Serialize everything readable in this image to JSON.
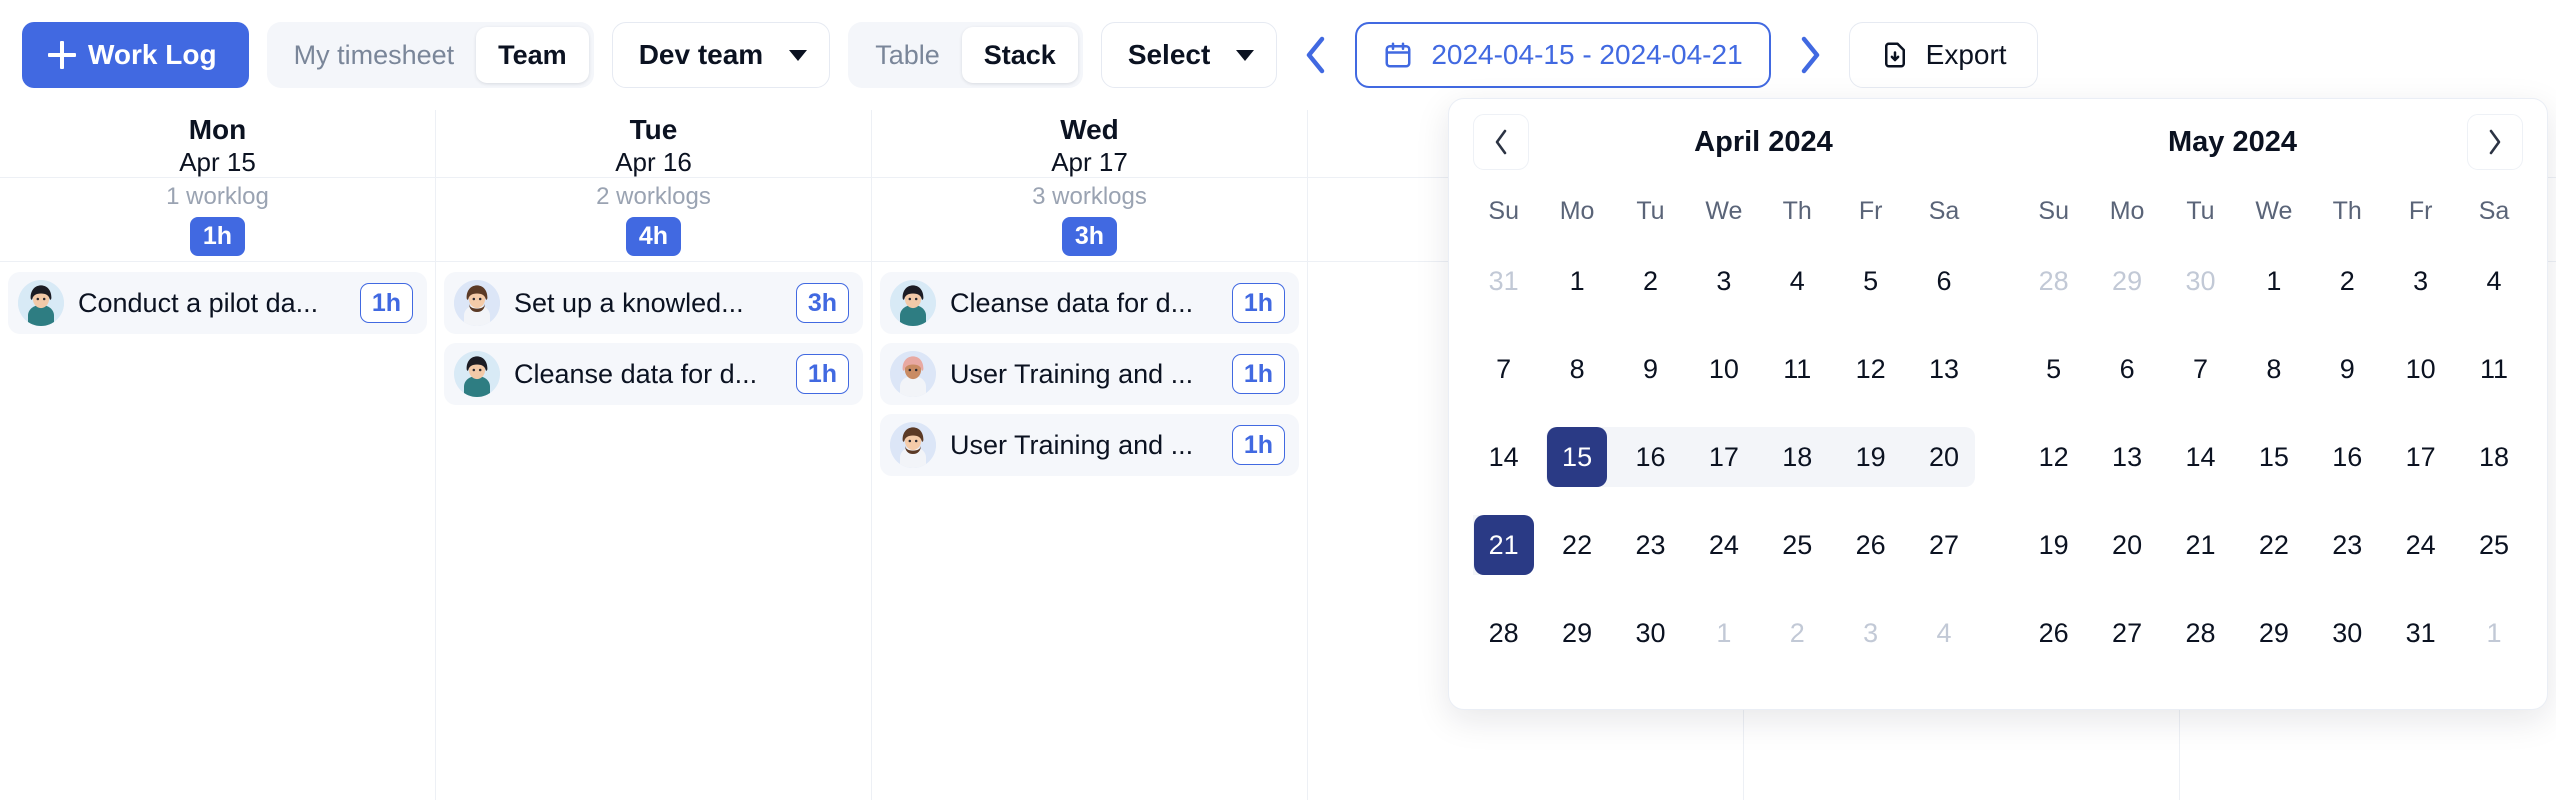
{
  "colors": {
    "primary": "#4169E1",
    "selected_day": "#2A3A85",
    "range_bg": "#F3F5F9",
    "card_bg": "#F5F7FB",
    "muted_text": "#9AA3B2"
  },
  "toolbar": {
    "work_log_button": "Work Log",
    "plus_icon": "plus-icon",
    "scope_segmented": {
      "options": [
        "My timesheet",
        "Team"
      ],
      "selected": "Team"
    },
    "team_dropdown": {
      "value": "Dev team",
      "chevron_icon": "chevron-down-icon"
    },
    "view_segmented": {
      "options": [
        "Table",
        "Stack"
      ],
      "selected": "Stack"
    },
    "select_dropdown": {
      "value": "Select",
      "chevron_icon": "chevron-down-icon"
    },
    "prev_week_icon": "chevron-left-icon",
    "next_week_icon": "chevron-right-icon",
    "date_range": {
      "value": "2024-04-15 - 2024-04-21",
      "calendar_icon": "calendar-icon"
    },
    "export_button": {
      "label": "Export",
      "icon": "file-download-icon"
    }
  },
  "week": {
    "columns": [
      {
        "day_name": "Mon",
        "day_date": "Apr 15",
        "worklog_count": "1 worklog",
        "total": "1h",
        "cards": [
          {
            "title": "Conduct a pilot da...",
            "hours": "1h",
            "avatar": "avatar-woman-dark-hair"
          }
        ]
      },
      {
        "day_name": "Tue",
        "day_date": "Apr 16",
        "worklog_count": "2 worklogs",
        "total": "4h",
        "cards": [
          {
            "title": "Set up a knowled...",
            "hours": "3h",
            "avatar": "avatar-man-beard"
          },
          {
            "title": "Cleanse data for d...",
            "hours": "1h",
            "avatar": "avatar-woman-dark-hair"
          }
        ]
      },
      {
        "day_name": "Wed",
        "day_date": "Apr 17",
        "worklog_count": "3 worklogs",
        "total": "3h",
        "cards": [
          {
            "title": "Cleanse data for d...",
            "hours": "1h",
            "avatar": "avatar-woman-dark-hair"
          },
          {
            "title": "User Training and ...",
            "hours": "1h",
            "avatar": "avatar-woman-curly-hair"
          },
          {
            "title": "User Training and ...",
            "hours": "1h",
            "avatar": "avatar-man-beard"
          }
        ]
      },
      {
        "day_name": "",
        "day_date": "",
        "worklog_count": "",
        "total": "",
        "cards": []
      },
      {
        "day_name": "",
        "day_date": "",
        "worklog_count": "",
        "total": "",
        "cards": []
      },
      {
        "day_name": "",
        "day_date": "",
        "worklog_count": "",
        "total": "",
        "cards": []
      }
    ]
  },
  "calendar": {
    "prev_icon": "chevron-left-icon",
    "next_icon": "chevron-right-icon",
    "left_month_title": "April 2024",
    "right_month_title": "May 2024",
    "weekday_labels": [
      "Su",
      "Mo",
      "Tu",
      "We",
      "Th",
      "Fr",
      "Sa"
    ],
    "april": {
      "weeks": [
        [
          {
            "d": "31",
            "muted": true
          },
          {
            "d": "1"
          },
          {
            "d": "2"
          },
          {
            "d": "3"
          },
          {
            "d": "4"
          },
          {
            "d": "5"
          },
          {
            "d": "6"
          }
        ],
        [
          {
            "d": "7"
          },
          {
            "d": "8"
          },
          {
            "d": "9"
          },
          {
            "d": "10"
          },
          {
            "d": "11"
          },
          {
            "d": "12"
          },
          {
            "d": "13"
          }
        ],
        [
          {
            "d": "14"
          },
          {
            "d": "15",
            "selected": true,
            "inrange": true,
            "range_start": true
          },
          {
            "d": "16",
            "inrange": true
          },
          {
            "d": "17",
            "inrange": true
          },
          {
            "d": "18",
            "inrange": true
          },
          {
            "d": "19",
            "inrange": true
          },
          {
            "d": "20",
            "inrange": true,
            "range_end": true
          }
        ],
        [
          {
            "d": "21",
            "selected": true,
            "inrange": true,
            "range_start": true,
            "range_end": true
          },
          {
            "d": "22"
          },
          {
            "d": "23"
          },
          {
            "d": "24"
          },
          {
            "d": "25"
          },
          {
            "d": "26"
          },
          {
            "d": "27"
          }
        ],
        [
          {
            "d": "28"
          },
          {
            "d": "29"
          },
          {
            "d": "30"
          },
          {
            "d": "1",
            "muted": true
          },
          {
            "d": "2",
            "muted": true
          },
          {
            "d": "3",
            "muted": true
          },
          {
            "d": "4",
            "muted": true
          }
        ]
      ]
    },
    "may": {
      "weeks": [
        [
          {
            "d": "28",
            "muted": true
          },
          {
            "d": "29",
            "muted": true
          },
          {
            "d": "30",
            "muted": true
          },
          {
            "d": "1"
          },
          {
            "d": "2"
          },
          {
            "d": "3"
          },
          {
            "d": "4"
          }
        ],
        [
          {
            "d": "5"
          },
          {
            "d": "6"
          },
          {
            "d": "7"
          },
          {
            "d": "8"
          },
          {
            "d": "9"
          },
          {
            "d": "10"
          },
          {
            "d": "11"
          }
        ],
        [
          {
            "d": "12"
          },
          {
            "d": "13"
          },
          {
            "d": "14"
          },
          {
            "d": "15"
          },
          {
            "d": "16"
          },
          {
            "d": "17"
          },
          {
            "d": "18"
          }
        ],
        [
          {
            "d": "19"
          },
          {
            "d": "20"
          },
          {
            "d": "21"
          },
          {
            "d": "22"
          },
          {
            "d": "23"
          },
          {
            "d": "24"
          },
          {
            "d": "25"
          }
        ],
        [
          {
            "d": "26"
          },
          {
            "d": "27"
          },
          {
            "d": "28"
          },
          {
            "d": "29"
          },
          {
            "d": "30"
          },
          {
            "d": "31"
          },
          {
            "d": "1",
            "muted": true
          }
        ]
      ]
    }
  }
}
